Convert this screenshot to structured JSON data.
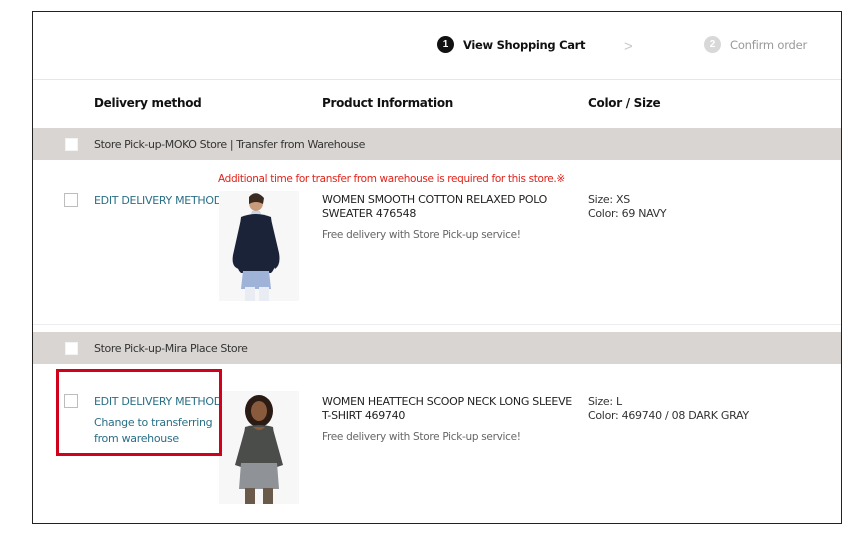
{
  "stepper": {
    "step1": {
      "number": "1",
      "label": "View Shopping Cart"
    },
    "arrow": ">",
    "step2": {
      "number": "2",
      "label": "Confirm order"
    }
  },
  "columns": {
    "delivery": "Delivery method",
    "product": "Product Information",
    "color_size": "Color / Size"
  },
  "groups": [
    {
      "label": "Store Pick-up-MOKO Store | Transfer from Warehouse",
      "warning": "Additional time for transfer from warehouse is required for this store.※",
      "item": {
        "edit_label": "EDIT DELIVERY METHOD",
        "name": "WOMEN SMOOTH COTTON RELAXED POLO SWEATER 476548",
        "note": "Free delivery with Store Pick-up service!",
        "size": "Size: XS",
        "color": "Color: 69 NAVY"
      }
    },
    {
      "label": "Store Pick-up-Mira Place Store",
      "item": {
        "edit_label": "EDIT DELIVERY METHOD",
        "change_label": "Change to transferring from warehouse",
        "name": "WOMEN HEATTECH SCOOP NECK LONG SLEEVE T-SHIRT 469740",
        "note": "Free delivery with Store Pick-up service!",
        "size": "Size: L",
        "color": "Color: 469740 / 08 DARK GRAY"
      }
    }
  ],
  "colors": {
    "group_bar": "#d9d5d2",
    "link": "#2a6f86",
    "warning": "#e2231a",
    "highlight": "#d0021b"
  }
}
